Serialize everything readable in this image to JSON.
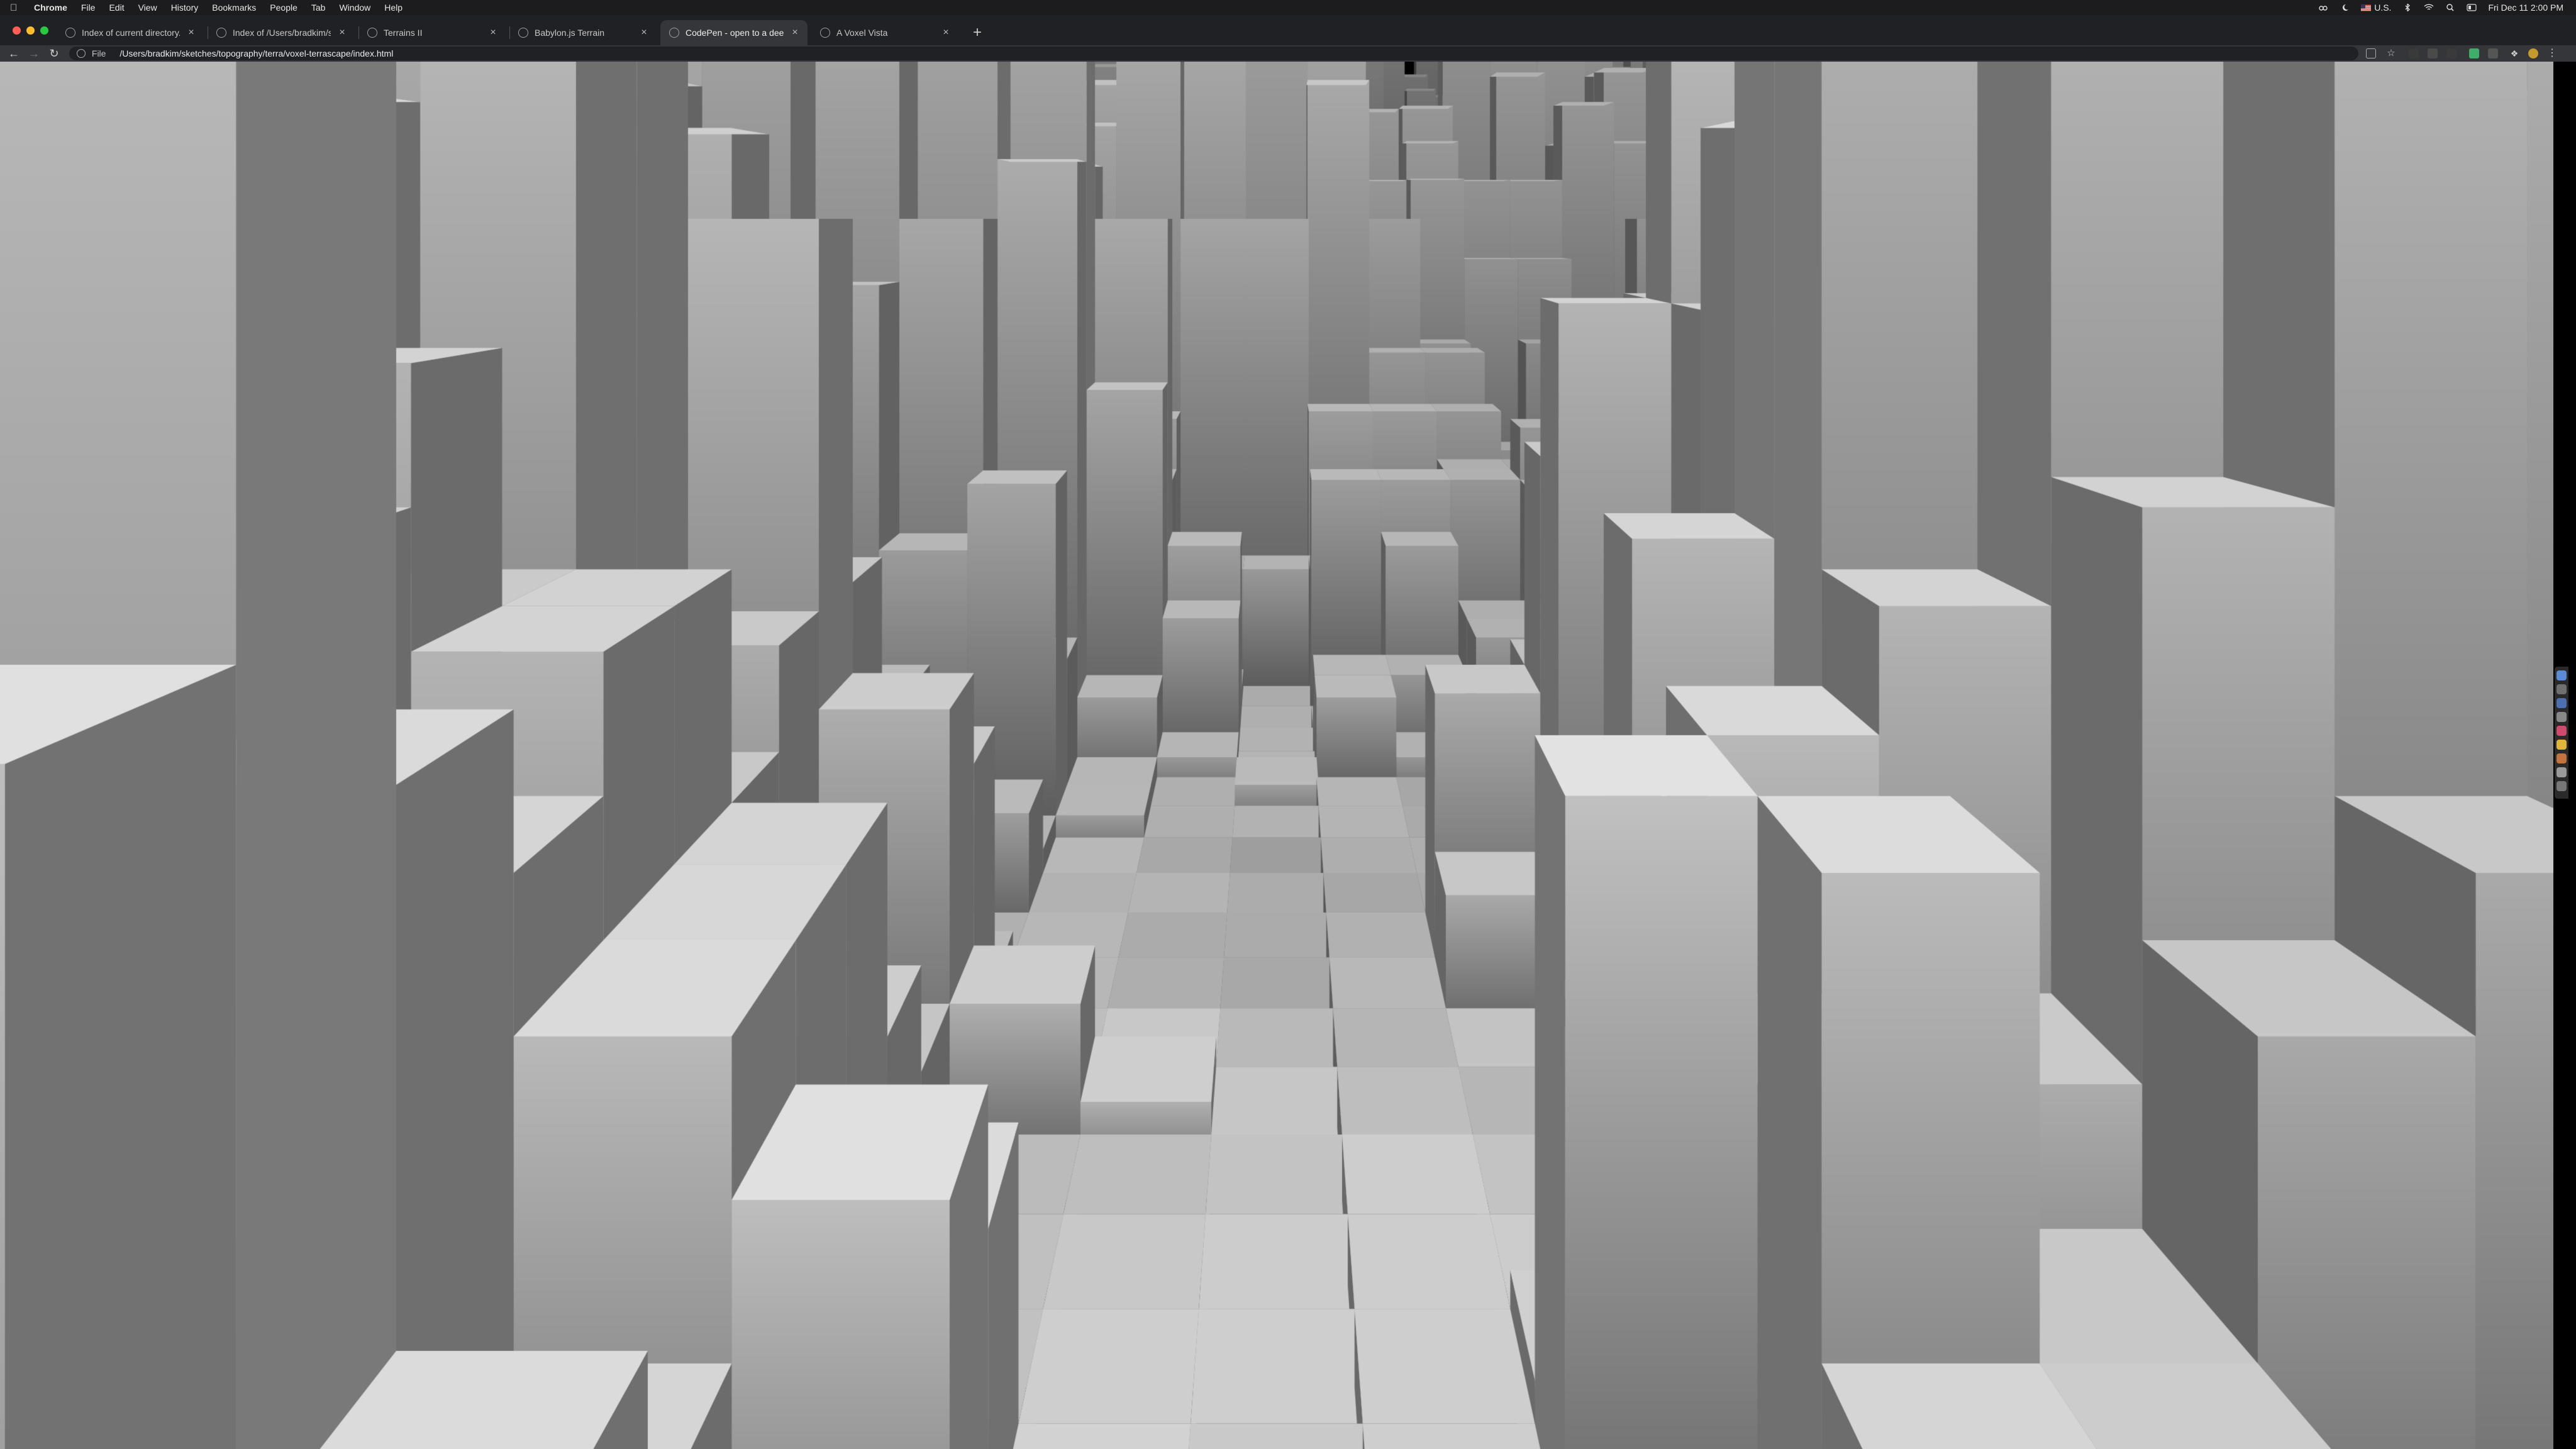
{
  "menubar": {
    "app_name": "Chrome",
    "menus": [
      "File",
      "Edit",
      "View",
      "History",
      "Bookmarks",
      "People",
      "Tab",
      "Window",
      "Help"
    ],
    "input_source": "U.S.",
    "clock": "Fri Dec 11  2:00 PM"
  },
  "tabs": [
    {
      "title": "Index of current directory...",
      "active": false
    },
    {
      "title": "Index of /Users/bradkim/sketc",
      "active": false
    },
    {
      "title": "Terrains II",
      "active": false
    },
    {
      "title": "Babylon.js Terrain",
      "active": false
    },
    {
      "title": "CodePen - open to a deep bra",
      "active": true
    },
    {
      "title": "A Voxel Vista",
      "active": false
    }
  ],
  "toolbar": {
    "scheme_label": "File",
    "url": "/Users/bradkim/sketches/topography/terra/voxel-terrascape/index.html"
  },
  "scene": {
    "description_label": "",
    "background_color": "#000000",
    "voxel_light": "#ececec",
    "voxel_mid": "#8a8a8a",
    "voxel_dark": "#1a1a1a"
  },
  "icons": {
    "back": "arrow-left-icon",
    "forward": "arrow-right-icon",
    "reload": "reload-icon",
    "info": "info-icon",
    "new_tab": "plus-icon",
    "close_tab": "close-icon"
  },
  "colors": {
    "traffic_close": "#ff5f57",
    "traffic_minimize": "#febc2e",
    "traffic_zoom": "#28c840"
  }
}
